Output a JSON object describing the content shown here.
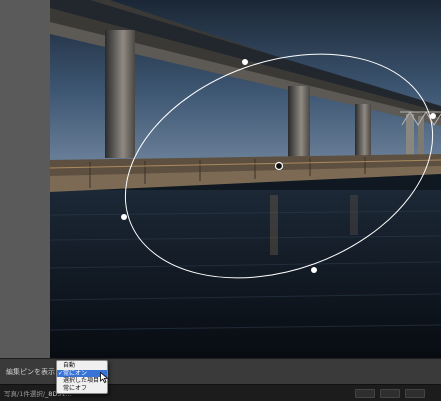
{
  "toolbar": {
    "edit_pins_label": "編集ピンを表示："
  },
  "pin_menu": {
    "items": [
      {
        "label": "自動",
        "checked": false,
        "highlighted": false
      },
      {
        "label": "常にオン",
        "checked": true,
        "highlighted": true
      },
      {
        "label": "選択した項目",
        "checked": false,
        "highlighted": false
      },
      {
        "label": "常にオフ",
        "checked": false,
        "highlighted": false
      }
    ]
  },
  "statusbar": {
    "photo_count": "写真/1件選択/",
    "filename": "_8D51..."
  },
  "colors": {
    "menu_highlight": "#3874d8",
    "panel_gray": "#5a5a5a",
    "mask_ellipse": "#ffffff"
  }
}
